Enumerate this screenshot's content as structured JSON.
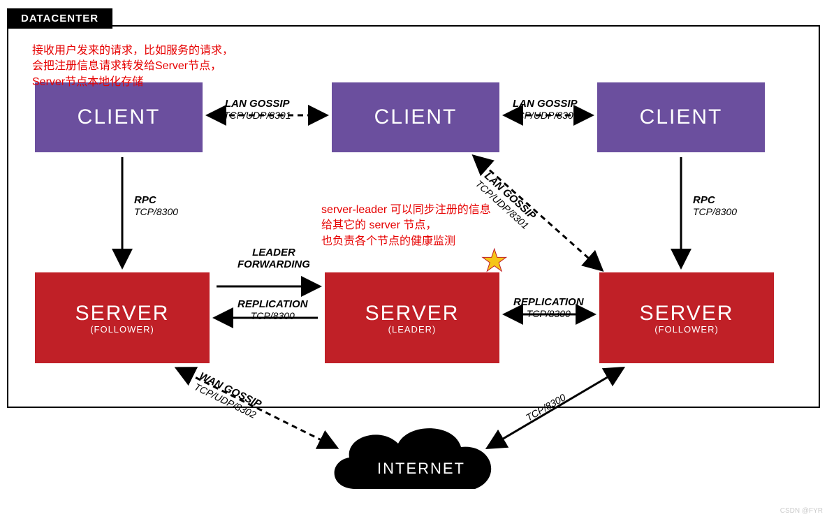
{
  "datacenter_label": "DATACENTER",
  "clients": [
    {
      "title": "CLIENT"
    },
    {
      "title": "CLIENT"
    },
    {
      "title": "CLIENT"
    }
  ],
  "servers": [
    {
      "title": "SERVER",
      "role": "(FOLLOWER)"
    },
    {
      "title": "SERVER",
      "role": "(LEADER)"
    },
    {
      "title": "SERVER",
      "role": "(FOLLOWER)"
    }
  ],
  "edges": {
    "lan_gossip_1": {
      "l1": "LAN GOSSIP",
      "l2": "TCP/UDP/8301"
    },
    "lan_gossip_2": {
      "l1": "LAN GOSSIP",
      "l2": "TCP/UDP/8301"
    },
    "lan_gossip_diag": {
      "l1": "LAN GOSSIP",
      "l2": "TCP/UDP/8301"
    },
    "rpc_left": {
      "l1": "RPC",
      "l2": "TCP/8300"
    },
    "rpc_right": {
      "l1": "RPC",
      "l2": "TCP/8300"
    },
    "leader_forwarding": {
      "l1": "LEADER",
      "l2": "FORWARDING"
    },
    "replication_left": {
      "l1": "REPLICATION",
      "l2": "TCP/8300"
    },
    "replication_right": {
      "l1": "REPLICATION",
      "l2": "TCP/8300"
    },
    "wan_gossip": {
      "l1": "WAN GOSSIP",
      "l2": "TCP/UDP/8302"
    },
    "tcp8300_right": {
      "l1": "TCP/8300"
    }
  },
  "annotations": {
    "client_note_l1": "接收用户发来的请求，比如服务的请求，",
    "client_note_l2": "会把注册信息请求转发给Server节点，",
    "client_note_l3": "Server节点本地化存储",
    "leader_note_l1": "server-leader 可以同步注册的信息",
    "leader_note_l2": "给其它的 server 节点，",
    "leader_note_l3": "也负责各个节点的健康监测"
  },
  "internet_label": "INTERNET",
  "watermark": "CSDN @FYR"
}
